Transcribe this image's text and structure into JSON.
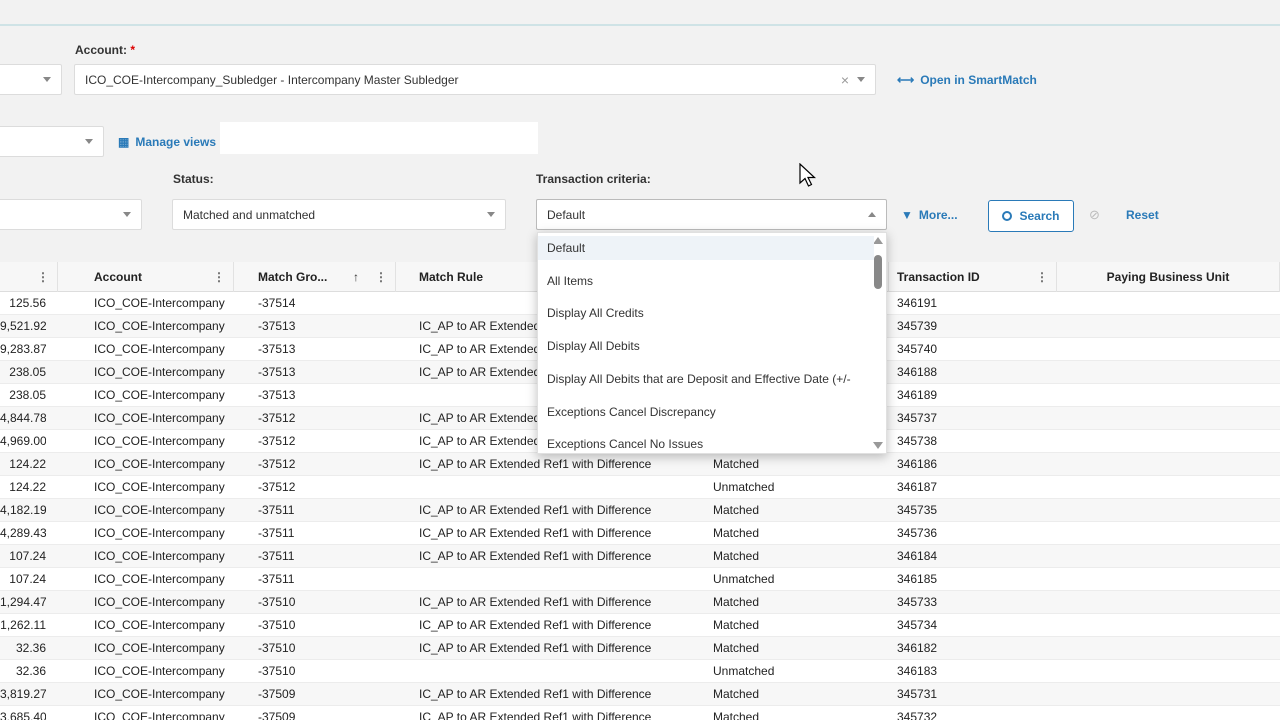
{
  "filters": {
    "account_label": "Account:",
    "account_required": "*",
    "account_value": "ICO_COE-Intercompany_Subledger - Intercompany Master Subledger",
    "account_clear": "×",
    "open_smartmatch": "Open in SmartMatch",
    "manage_views": "Manage views",
    "status_label": "Status:",
    "status_value": "Matched and unmatched",
    "criteria_label": "Transaction criteria:",
    "criteria_value": "Default",
    "more": "More...",
    "search": "Search",
    "reset": "Reset"
  },
  "dropdown": {
    "items": [
      "Default",
      "All Items",
      "Display All Credits",
      "Display All Debits",
      "Display All Debits that are Deposit and Effective Date (+/-",
      "Exceptions Cancel Discrepancy",
      "Exceptions Cancel No Issues"
    ]
  },
  "grid": {
    "headers": {
      "account": "Account",
      "match_group": "Match Gro...",
      "match_rule": "Match Rule",
      "transaction_id": "Transaction ID",
      "paying_bu": "Paying Business Unit"
    },
    "rows": [
      {
        "amount": "125.56",
        "account": "ICO_COE-Intercompany",
        "match_group": "-37514",
        "match_rule": "",
        "status": "",
        "transaction_id": "346191"
      },
      {
        "amount": "9,521.92",
        "account": "ICO_COE-Intercompany",
        "match_group": "-37513",
        "match_rule": "IC_AP to AR Extended Ref1 with Difference",
        "status": "",
        "transaction_id": "345739"
      },
      {
        "amount": "9,283.87",
        "account": "ICO_COE-Intercompany",
        "match_group": "-37513",
        "match_rule": "IC_AP to AR Extended Ref1 with Difference",
        "status": "",
        "transaction_id": "345740"
      },
      {
        "amount": "238.05",
        "account": "ICO_COE-Intercompany",
        "match_group": "-37513",
        "match_rule": "IC_AP to AR Extended Ref1 with Difference",
        "status": "",
        "transaction_id": "346188"
      },
      {
        "amount": "238.05",
        "account": "ICO_COE-Intercompany",
        "match_group": "-37513",
        "match_rule": "",
        "status": "",
        "transaction_id": "346189"
      },
      {
        "amount": "4,844.78",
        "account": "ICO_COE-Intercompany",
        "match_group": "-37512",
        "match_rule": "IC_AP to AR Extended Ref1 with Difference",
        "status": "",
        "transaction_id": "345737"
      },
      {
        "amount": "4,969.00",
        "account": "ICO_COE-Intercompany",
        "match_group": "-37512",
        "match_rule": "IC_AP to AR Extended Ref1 with Difference",
        "status": "",
        "transaction_id": "345738"
      },
      {
        "amount": "124.22",
        "account": "ICO_COE-Intercompany",
        "match_group": "-37512",
        "match_rule": "IC_AP to AR Extended Ref1 with Difference",
        "status": "Matched",
        "transaction_id": "346186"
      },
      {
        "amount": "124.22",
        "account": "ICO_COE-Intercompany",
        "match_group": "-37512",
        "match_rule": "",
        "status": "Unmatched",
        "transaction_id": "346187"
      },
      {
        "amount": "4,182.19",
        "account": "ICO_COE-Intercompany",
        "match_group": "-37511",
        "match_rule": "IC_AP to AR Extended Ref1 with Difference",
        "status": "Matched",
        "transaction_id": "345735"
      },
      {
        "amount": "4,289.43",
        "account": "ICO_COE-Intercompany",
        "match_group": "-37511",
        "match_rule": "IC_AP to AR Extended Ref1 with Difference",
        "status": "Matched",
        "transaction_id": "345736"
      },
      {
        "amount": "107.24",
        "account": "ICO_COE-Intercompany",
        "match_group": "-37511",
        "match_rule": "IC_AP to AR Extended Ref1 with Difference",
        "status": "Matched",
        "transaction_id": "346184"
      },
      {
        "amount": "107.24",
        "account": "ICO_COE-Intercompany",
        "match_group": "-37511",
        "match_rule": "",
        "status": "Unmatched",
        "transaction_id": "346185"
      },
      {
        "amount": "1,294.47",
        "account": "ICO_COE-Intercompany",
        "match_group": "-37510",
        "match_rule": "IC_AP to AR Extended Ref1 with Difference",
        "status": "Matched",
        "transaction_id": "345733"
      },
      {
        "amount": "1,262.11",
        "account": "ICO_COE-Intercompany",
        "match_group": "-37510",
        "match_rule": "IC_AP to AR Extended Ref1 with Difference",
        "status": "Matched",
        "transaction_id": "345734"
      },
      {
        "amount": "32.36",
        "account": "ICO_COE-Intercompany",
        "match_group": "-37510",
        "match_rule": "IC_AP to AR Extended Ref1 with Difference",
        "status": "Matched",
        "transaction_id": "346182"
      },
      {
        "amount": "32.36",
        "account": "ICO_COE-Intercompany",
        "match_group": "-37510",
        "match_rule": "",
        "status": "Unmatched",
        "transaction_id": "346183"
      },
      {
        "amount": "3,819.27",
        "account": "ICO_COE-Intercompany",
        "match_group": "-37509",
        "match_rule": "IC_AP to AR Extended Ref1 with Difference",
        "status": "Matched",
        "transaction_id": "345731"
      },
      {
        "amount": "3,685.40",
        "account": "ICO_COE-Intercompany",
        "match_group": "-37509",
        "match_rule": "IC_AP to AR Extended Ref1 with Difference",
        "status": "Matched",
        "transaction_id": "345732"
      }
    ]
  },
  "colors": {
    "accent": "#2a7ab8",
    "required": "#dd0000"
  }
}
